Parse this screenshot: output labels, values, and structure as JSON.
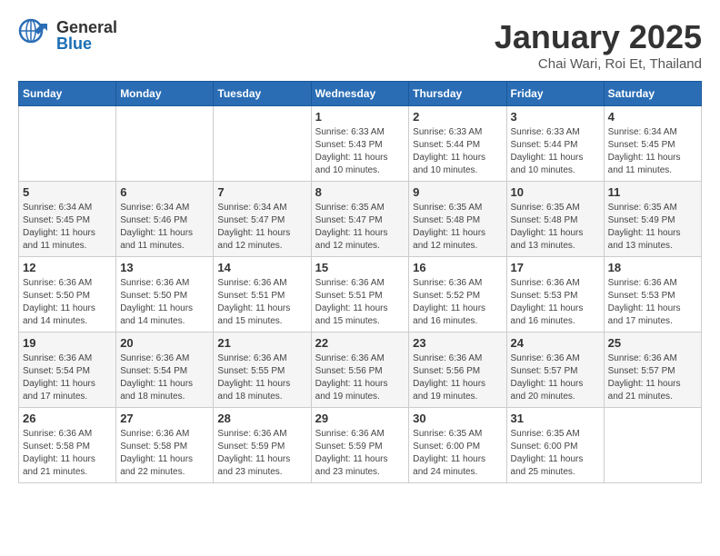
{
  "header": {
    "logo_general": "General",
    "logo_blue": "Blue",
    "month_title": "January 2025",
    "location": "Chai Wari, Roi Et, Thailand"
  },
  "weekdays": [
    "Sunday",
    "Monday",
    "Tuesday",
    "Wednesday",
    "Thursday",
    "Friday",
    "Saturday"
  ],
  "weeks": [
    [
      {
        "day": "",
        "info": ""
      },
      {
        "day": "",
        "info": ""
      },
      {
        "day": "",
        "info": ""
      },
      {
        "day": "1",
        "info": "Sunrise: 6:33 AM\nSunset: 5:43 PM\nDaylight: 11 hours and 10 minutes."
      },
      {
        "day": "2",
        "info": "Sunrise: 6:33 AM\nSunset: 5:44 PM\nDaylight: 11 hours and 10 minutes."
      },
      {
        "day": "3",
        "info": "Sunrise: 6:33 AM\nSunset: 5:44 PM\nDaylight: 11 hours and 10 minutes."
      },
      {
        "day": "4",
        "info": "Sunrise: 6:34 AM\nSunset: 5:45 PM\nDaylight: 11 hours and 11 minutes."
      }
    ],
    [
      {
        "day": "5",
        "info": "Sunrise: 6:34 AM\nSunset: 5:45 PM\nDaylight: 11 hours and 11 minutes."
      },
      {
        "day": "6",
        "info": "Sunrise: 6:34 AM\nSunset: 5:46 PM\nDaylight: 11 hours and 11 minutes."
      },
      {
        "day": "7",
        "info": "Sunrise: 6:34 AM\nSunset: 5:47 PM\nDaylight: 11 hours and 12 minutes."
      },
      {
        "day": "8",
        "info": "Sunrise: 6:35 AM\nSunset: 5:47 PM\nDaylight: 11 hours and 12 minutes."
      },
      {
        "day": "9",
        "info": "Sunrise: 6:35 AM\nSunset: 5:48 PM\nDaylight: 11 hours and 12 minutes."
      },
      {
        "day": "10",
        "info": "Sunrise: 6:35 AM\nSunset: 5:48 PM\nDaylight: 11 hours and 13 minutes."
      },
      {
        "day": "11",
        "info": "Sunrise: 6:35 AM\nSunset: 5:49 PM\nDaylight: 11 hours and 13 minutes."
      }
    ],
    [
      {
        "day": "12",
        "info": "Sunrise: 6:36 AM\nSunset: 5:50 PM\nDaylight: 11 hours and 14 minutes."
      },
      {
        "day": "13",
        "info": "Sunrise: 6:36 AM\nSunset: 5:50 PM\nDaylight: 11 hours and 14 minutes."
      },
      {
        "day": "14",
        "info": "Sunrise: 6:36 AM\nSunset: 5:51 PM\nDaylight: 11 hours and 15 minutes."
      },
      {
        "day": "15",
        "info": "Sunrise: 6:36 AM\nSunset: 5:51 PM\nDaylight: 11 hours and 15 minutes."
      },
      {
        "day": "16",
        "info": "Sunrise: 6:36 AM\nSunset: 5:52 PM\nDaylight: 11 hours and 16 minutes."
      },
      {
        "day": "17",
        "info": "Sunrise: 6:36 AM\nSunset: 5:53 PM\nDaylight: 11 hours and 16 minutes."
      },
      {
        "day": "18",
        "info": "Sunrise: 6:36 AM\nSunset: 5:53 PM\nDaylight: 11 hours and 17 minutes."
      }
    ],
    [
      {
        "day": "19",
        "info": "Sunrise: 6:36 AM\nSunset: 5:54 PM\nDaylight: 11 hours and 17 minutes."
      },
      {
        "day": "20",
        "info": "Sunrise: 6:36 AM\nSunset: 5:54 PM\nDaylight: 11 hours and 18 minutes."
      },
      {
        "day": "21",
        "info": "Sunrise: 6:36 AM\nSunset: 5:55 PM\nDaylight: 11 hours and 18 minutes."
      },
      {
        "day": "22",
        "info": "Sunrise: 6:36 AM\nSunset: 5:56 PM\nDaylight: 11 hours and 19 minutes."
      },
      {
        "day": "23",
        "info": "Sunrise: 6:36 AM\nSunset: 5:56 PM\nDaylight: 11 hours and 19 minutes."
      },
      {
        "day": "24",
        "info": "Sunrise: 6:36 AM\nSunset: 5:57 PM\nDaylight: 11 hours and 20 minutes."
      },
      {
        "day": "25",
        "info": "Sunrise: 6:36 AM\nSunset: 5:57 PM\nDaylight: 11 hours and 21 minutes."
      }
    ],
    [
      {
        "day": "26",
        "info": "Sunrise: 6:36 AM\nSunset: 5:58 PM\nDaylight: 11 hours and 21 minutes."
      },
      {
        "day": "27",
        "info": "Sunrise: 6:36 AM\nSunset: 5:58 PM\nDaylight: 11 hours and 22 minutes."
      },
      {
        "day": "28",
        "info": "Sunrise: 6:36 AM\nSunset: 5:59 PM\nDaylight: 11 hours and 23 minutes."
      },
      {
        "day": "29",
        "info": "Sunrise: 6:36 AM\nSunset: 5:59 PM\nDaylight: 11 hours and 23 minutes."
      },
      {
        "day": "30",
        "info": "Sunrise: 6:35 AM\nSunset: 6:00 PM\nDaylight: 11 hours and 24 minutes."
      },
      {
        "day": "31",
        "info": "Sunrise: 6:35 AM\nSunset: 6:00 PM\nDaylight: 11 hours and 25 minutes."
      },
      {
        "day": "",
        "info": ""
      }
    ]
  ]
}
